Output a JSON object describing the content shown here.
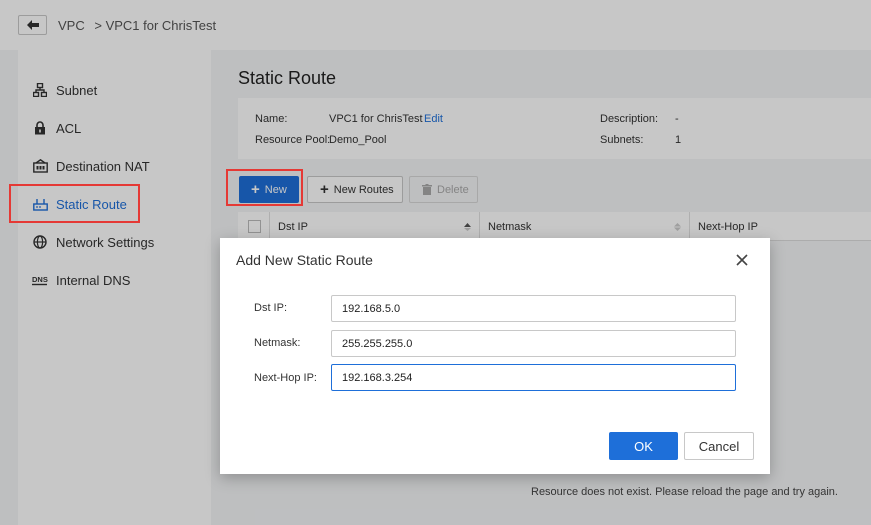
{
  "header": {
    "breadcrumb_root": "VPC",
    "breadcrumb_current": "> VPC1 for ChrisTest"
  },
  "sidebar": {
    "items": [
      {
        "label": "Subnet",
        "icon": "subnet-icon"
      },
      {
        "label": "ACL",
        "icon": "lock-icon"
      },
      {
        "label": "Destination NAT",
        "icon": "nat-icon"
      },
      {
        "label": "Static Route",
        "icon": "router-icon",
        "active": true
      },
      {
        "label": "Network Settings",
        "icon": "globe-icon"
      },
      {
        "label": "Internal DNS",
        "icon": "dns-icon"
      }
    ]
  },
  "main": {
    "title": "Static Route",
    "info": {
      "name_label": "Name:",
      "name_value": "VPC1 for ChrisTest",
      "edit_label": "Edit",
      "pool_label": "Resource Pool:",
      "pool_value": "Demo_Pool",
      "desc_label": "Description:",
      "desc_value": "-",
      "subnets_label": "Subnets:",
      "subnets_value": "1"
    },
    "toolbar": {
      "new_label": "New",
      "new_routes_label": "New Routes",
      "delete_label": "Delete"
    },
    "table": {
      "columns": [
        "Dst IP",
        "Netmask",
        "Next-Hop IP"
      ]
    },
    "empty_message": "Resource does not exist. Please reload the page and try again."
  },
  "dialog": {
    "title": "Add New Static Route",
    "fields": {
      "dst_ip_label": "Dst IP:",
      "dst_ip_value": "192.168.5.0",
      "netmask_label": "Netmask:",
      "netmask_value": "255.255.255.0",
      "nexthop_label": "Next-Hop IP:",
      "nexthop_value": "192.168.3.254"
    },
    "ok_label": "OK",
    "cancel_label": "Cancel"
  },
  "colors": {
    "accent": "#1e6fd9",
    "highlight": "#e53935"
  }
}
